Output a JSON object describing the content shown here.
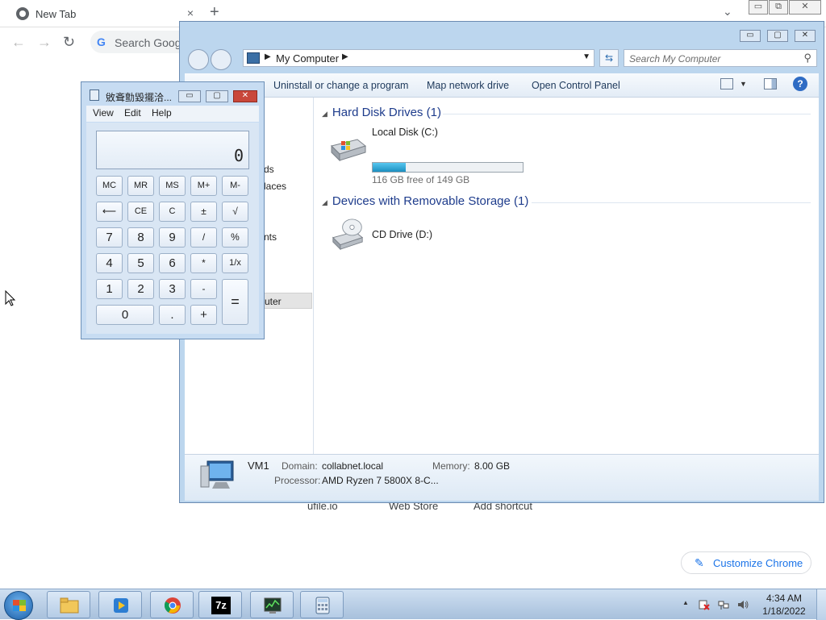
{
  "chrome": {
    "tab_title": "New Tab",
    "tab_close": "×",
    "new_tab": "+",
    "tab_search": "⌄",
    "back": "←",
    "forward": "→",
    "reload": "↻",
    "omnibox_g": "G",
    "omnibox_text": "Search Goog",
    "window_minimize": "▭",
    "window_restore": "⧉",
    "window_close": "✕",
    "shortcuts": [
      "ufile.io",
      "Web Store",
      "Add shortcut"
    ],
    "customize_icon": "✎",
    "customize_label": "Customize Chrome"
  },
  "explorer": {
    "address_crumb": "My Computer",
    "search_placeholder": "Search My Computer",
    "commands": [
      "Uninstall or change a program",
      "Map network drive",
      "Open Control Panel"
    ],
    "nav_items": [
      "ds",
      "laces",
      "nts",
      "uter"
    ],
    "groups": [
      {
        "title": "Hard Disk Drives (1)"
      },
      {
        "title": "Devices with Removable Storage (1)"
      }
    ],
    "local_disk": {
      "name": "Local Disk (C:)",
      "free_text": "116 GB free of 149 GB",
      "used_fraction": 0.22
    },
    "cd_drive": {
      "name": "CD Drive (D:)"
    },
    "details": {
      "computer_name": "VM1",
      "domain_label": "Domain:",
      "domain_value": "collabnet.local",
      "memory_label": "Memory:",
      "memory_value": "8.00 GB",
      "processor_label": "Processor:",
      "processor_value": "AMD Ryzen 7 5800X 8-C..."
    }
  },
  "calculator": {
    "title": "敓斊勯毀擺洽...",
    "menu": [
      "View",
      "Edit",
      "Help"
    ],
    "display": "0",
    "keys": {
      "mc": "MC",
      "mr": "MR",
      "ms": "MS",
      "mplus": "M+",
      "mminus": "M-",
      "back": "⟵",
      "ce": "CE",
      "c": "C",
      "plusminus": "±",
      "sqrt": "√",
      "k7": "7",
      "k8": "8",
      "k9": "9",
      "div": "/",
      "pct": "%",
      "k4": "4",
      "k5": "5",
      "k6": "6",
      "mul": "*",
      "recip": "1/x",
      "k1": "1",
      "k2": "2",
      "k3": "3",
      "sub": "-",
      "k0": "0",
      "dot": ".",
      "add": "+",
      "eq": "="
    }
  },
  "taskbar": {
    "apps": [
      "file-explorer",
      "media-player",
      "chrome",
      "7-zip",
      "task-manager",
      "calculator"
    ],
    "app_labels": {
      "seven_zip": "7z"
    },
    "clock_time": "4:34 AM",
    "clock_date": "1/18/2022"
  }
}
